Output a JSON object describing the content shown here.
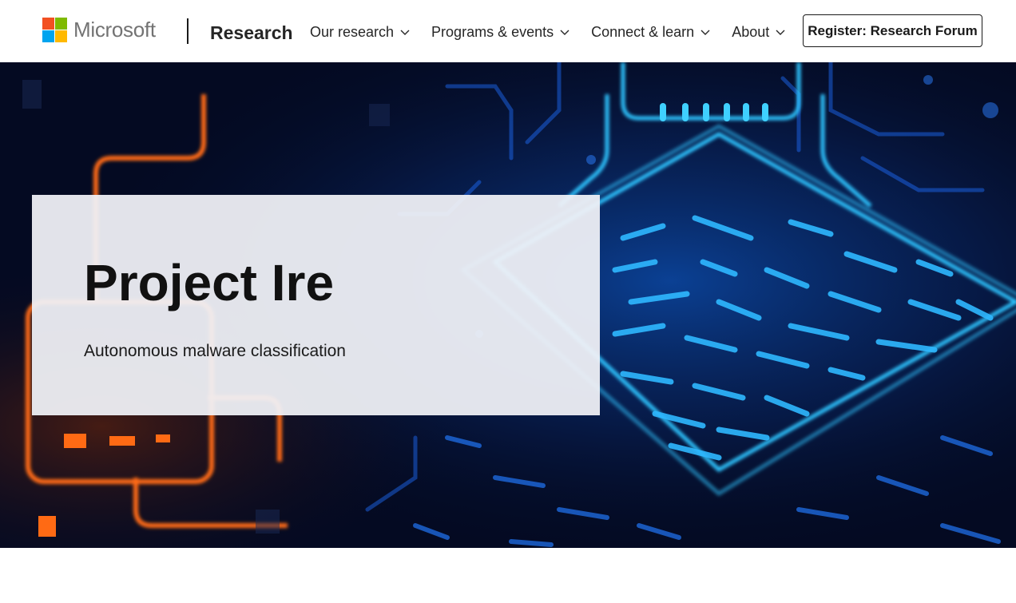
{
  "header": {
    "logo": {
      "wordmark": "Microsoft",
      "colors": [
        "#f25022",
        "#7fba00",
        "#00a4ef",
        "#ffb900"
      ]
    },
    "brand": "Research",
    "nav": [
      {
        "label": "Our research",
        "icon": "chevron-down-icon"
      },
      {
        "label": "Programs & events",
        "icon": "chevron-down-icon"
      },
      {
        "label": "Connect & learn",
        "icon": "chevron-down-icon"
      },
      {
        "label": "About",
        "icon": "chevron-down-icon"
      }
    ],
    "cta_label": "Register: Research Forum"
  },
  "hero": {
    "title": "Project Ire",
    "subtitle": "Autonomous malware classification",
    "image": {
      "subject": "glowing circuit board",
      "primary_color": "#1fb6ff",
      "accent_color": "#ff7a1a",
      "background_color": "#040a22"
    }
  }
}
